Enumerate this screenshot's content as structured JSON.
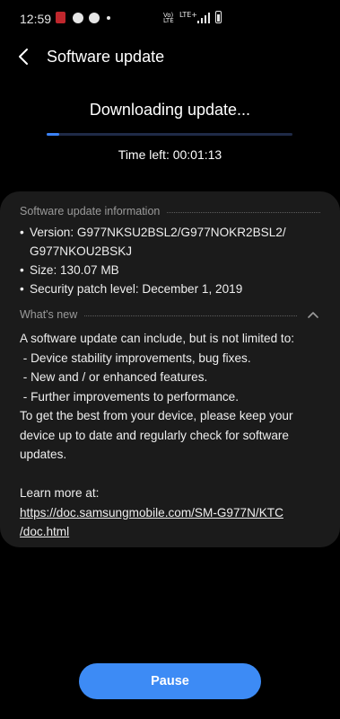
{
  "status_bar": {
    "time": "12:59",
    "network_text_top": "Vo)",
    "network_text_mid": "LTE",
    "network_text_lte": "LTE+",
    "icons": [
      "app-notification-icon",
      "messenger-icon",
      "messenger-icon",
      "dot-icon",
      "volte-icon",
      "lte-plus-icon",
      "signal-icon",
      "battery-icon"
    ]
  },
  "header": {
    "back_icon": "back-arrow-icon",
    "title": "Software update"
  },
  "download": {
    "status": "Downloading update...",
    "progress_percent": 5,
    "time_left": "Time left: 00:01:13",
    "progress_color": "#3b82f6"
  },
  "info": {
    "section_title": "Software update information",
    "items": [
      "Version: G977NKSU2BSL2/G977NOKR2BSL2/",
      "G977NKOU2BSKJ",
      "Size: 130.07 MB",
      "Security patch level: December 1, 2019"
    ]
  },
  "whats_new": {
    "section_title": "What's new",
    "collapse_icon": "chevron-up-icon",
    "lines": [
      "A software update can include, but is not limited to:",
      " - Device stability improvements, bug fixes.",
      " - New and / or enhanced features.",
      " - Further improvements to performance.",
      "To get the best from your device, please keep your",
      "device up to date and regularly check for software",
      "updates.",
      "",
      "Learn more at:"
    ],
    "link_line_1": "https://doc.samsungmobile.com/SM-G977N/KTC",
    "link_line_2": "/doc.html"
  },
  "actions": {
    "pause_label": "Pause",
    "accent_color": "#3d8bf5"
  }
}
